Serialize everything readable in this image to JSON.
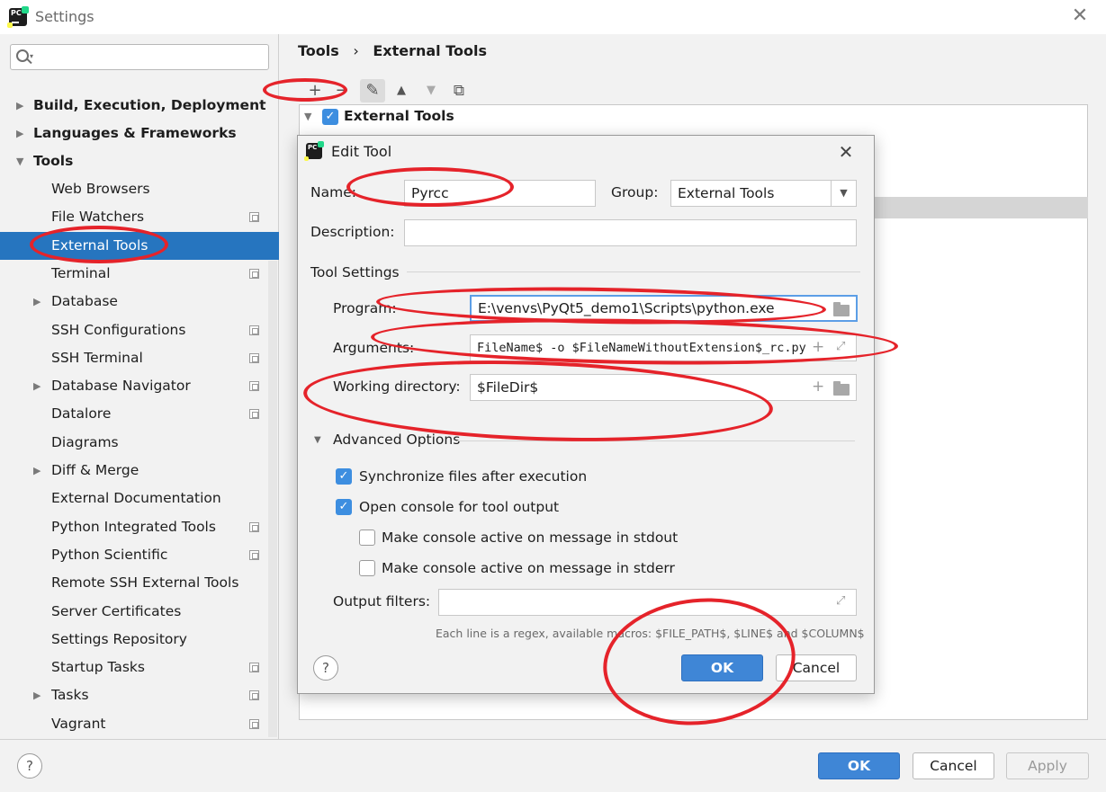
{
  "window": {
    "title": "Settings",
    "close_glyph": "✕"
  },
  "search": {
    "placeholder": "",
    "dropdown_glyph": "▾"
  },
  "sidebar": {
    "groups": [
      {
        "label": "Build, Execution, Deployment",
        "arrow": "▶"
      },
      {
        "label": "Languages & Frameworks",
        "arrow": "▶"
      },
      {
        "label": "Tools",
        "arrow": "▼"
      }
    ],
    "items": [
      {
        "label": "Web Browsers",
        "has_arrow": false,
        "project_icon": false
      },
      {
        "label": "File Watchers",
        "has_arrow": false,
        "project_icon": true
      },
      {
        "label": "External Tools",
        "has_arrow": false,
        "project_icon": false,
        "selected": true
      },
      {
        "label": "Terminal",
        "has_arrow": false,
        "project_icon": true
      },
      {
        "label": "Database",
        "has_arrow": true,
        "project_icon": false
      },
      {
        "label": "SSH Configurations",
        "has_arrow": false,
        "project_icon": true
      },
      {
        "label": "SSH Terminal",
        "has_arrow": false,
        "project_icon": true
      },
      {
        "label": "Database Navigator",
        "has_arrow": true,
        "project_icon": true
      },
      {
        "label": "Datalore",
        "has_arrow": false,
        "project_icon": true
      },
      {
        "label": "Diagrams",
        "has_arrow": false,
        "project_icon": false
      },
      {
        "label": "Diff & Merge",
        "has_arrow": true,
        "project_icon": false
      },
      {
        "label": "External Documentation",
        "has_arrow": false,
        "project_icon": false
      },
      {
        "label": "Python Integrated Tools",
        "has_arrow": false,
        "project_icon": true
      },
      {
        "label": "Python Scientific",
        "has_arrow": false,
        "project_icon": true
      },
      {
        "label": "Remote SSH External Tools",
        "has_arrow": false,
        "project_icon": false
      },
      {
        "label": "Server Certificates",
        "has_arrow": false,
        "project_icon": false
      },
      {
        "label": "Settings Repository",
        "has_arrow": false,
        "project_icon": false
      },
      {
        "label": "Startup Tasks",
        "has_arrow": false,
        "project_icon": true
      },
      {
        "label": "Tasks",
        "has_arrow": true,
        "project_icon": true
      },
      {
        "label": "Vagrant",
        "has_arrow": false,
        "project_icon": true
      }
    ],
    "arrow_glyph": "▶"
  },
  "breadcrumb": {
    "part1": "Tools",
    "sep": "›",
    "part2": "External Tools"
  },
  "toolbar": {
    "add": "+",
    "remove": "−",
    "edit": "✎",
    "up": "▲",
    "down": "▼",
    "copy": "⧉"
  },
  "tools_tree": {
    "arrow": "▼",
    "check": "✓",
    "label": "External Tools"
  },
  "dialog": {
    "title": "Edit Tool",
    "close_glyph": "✕",
    "name_label": "Name:",
    "name_value": "Pyrcc",
    "group_label": "Group:",
    "group_value": "External Tools",
    "group_dropdown_glyph": "▼",
    "description_label": "Description:",
    "description_value": "",
    "tool_settings_label": "Tool Settings",
    "program_label": "Program:",
    "program_value": "E:\\venvs\\PyQt5_demo1\\Scripts\\python.exe",
    "arguments_label": "Arguments:",
    "arguments_value": "FileName$ -o $FileNameWithoutExtension$_rc.py",
    "working_dir_label": "Working directory:",
    "working_dir_value": "$FileDir$",
    "advanced_label": "Advanced Options",
    "advanced_arrow": "▼",
    "sync_label": "Synchronize files after execution",
    "sync_checked": true,
    "open_console_label": "Open console for tool output",
    "open_console_checked": true,
    "stdout_label": "Make console active on message in stdout",
    "stdout_checked": false,
    "stderr_label": "Make console active on message in stderr",
    "stderr_checked": false,
    "output_filters_label": "Output filters:",
    "output_filters_value": "",
    "hint": "Each line is a regex, available macros: $FILE_PATH$, $LINE$ and $COLUMN$",
    "help_glyph": "?",
    "ok_label": "OK",
    "cancel_label": "Cancel",
    "check_glyph": "✓",
    "plus_glyph": "+",
    "expand_glyph": "⤢"
  },
  "footer": {
    "help_glyph": "?",
    "ok_label": "OK",
    "cancel_label": "Cancel",
    "apply_label": "Apply"
  },
  "colors": {
    "selection": "#2675bf",
    "primary_button": "#3f86d6",
    "annotation_red": "#e5232a",
    "checkbox": "#3d8ee0"
  }
}
